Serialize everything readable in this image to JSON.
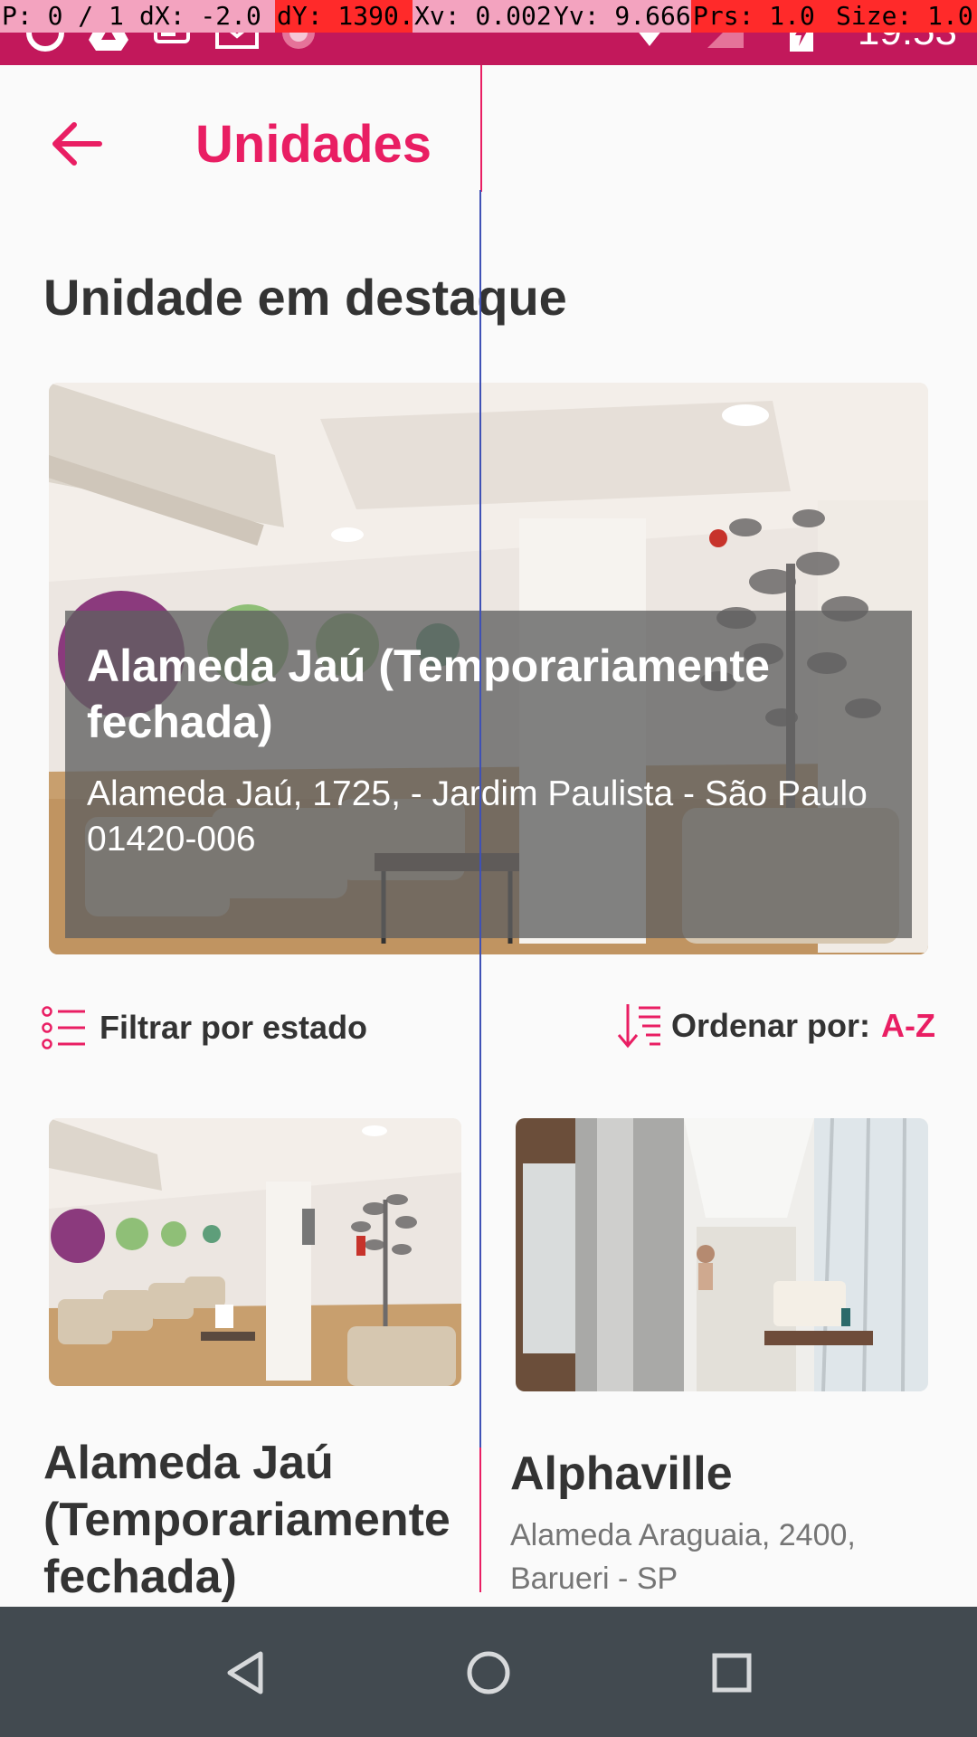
{
  "pointer_overlay": {
    "cells": [
      {
        "text": "P: 0 / 1",
        "bg": "#f3a3bf"
      },
      {
        "text": "dX: -2.0",
        "bg": "#f3a3bf"
      },
      {
        "text": "dY: 1390.0",
        "bg": "#ff2a2a"
      },
      {
        "text": "Xv: 0.002",
        "bg": "#f3a3bf"
      },
      {
        "text": "Yv: 9.666",
        "bg": "#f3a3bf"
      },
      {
        "text": "Prs: 1.0",
        "bg": "#ff2a2a"
      },
      {
        "text": "Size: 1.0",
        "bg": "#ff2a2a"
      }
    ]
  },
  "status_bar": {
    "time": "19:53",
    "left_icons": [
      "sync-icon",
      "drive-icon",
      "chat-icon",
      "gmail-icon",
      "circle-app-icon"
    ],
    "right_icons": [
      "wifi-icon",
      "no-signal-icon",
      "battery-charging-icon"
    ]
  },
  "app_bar": {
    "title": "Unidades",
    "back_icon": "arrow-left-icon"
  },
  "featured": {
    "section_title": "Unidade em destaque",
    "name": "Alameda Jaú (Temporariamente\nfechada)",
    "address_line1": "Alameda Jaú, 1725,  - Jardim Paulista - São Paulo",
    "address_line2": "01420-006"
  },
  "filters": {
    "filter_label": "Filtrar por estado",
    "sort_label": "Ordenar por:",
    "sort_value": "A-Z"
  },
  "units": [
    {
      "name": "Alameda Jaú\n(Temporariamente\nfechada)",
      "address": ""
    },
    {
      "name": "Alphaville",
      "address": "Alameda Araguaia, 2400, Barueri - SP"
    }
  ],
  "nav_bar": {
    "icons": [
      "back-triangle-icon",
      "home-circle-icon",
      "recents-square-icon"
    ]
  },
  "colors": {
    "accent": "#e91e63",
    "status_bar": "#c2185b",
    "nav_bar": "#424a50"
  }
}
